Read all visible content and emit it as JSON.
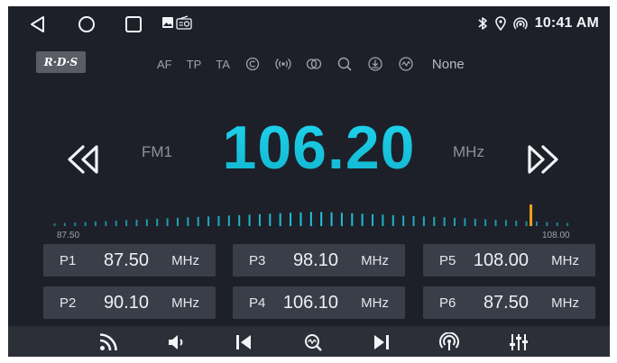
{
  "status": {
    "time": "10:41 AM",
    "icons": [
      "bluetooth-icon",
      "location-icon",
      "hotspot-icon"
    ]
  },
  "nav": [
    "back-icon",
    "home-icon",
    "recents-icon",
    "gallery-icon",
    "radio-icon"
  ],
  "rds": {
    "badge": "R·D·S",
    "items": [
      "AF",
      "TP",
      "TA"
    ],
    "icons": [
      "eon-icon",
      "broadcast-icon",
      "stereo-icon",
      "search-icon",
      "download-icon",
      "signal-icon"
    ],
    "none_label": "None"
  },
  "tuner": {
    "band": "FM1",
    "frequency": "106.20",
    "unit": "MHz",
    "scale_min_label": "87.50",
    "scale_max_label": "108.00",
    "scale_min": 87.5,
    "scale_max": 108.0,
    "current_value": 106.2,
    "accent": "#1fc9e2",
    "marker_color": "#f0a21a"
  },
  "presets": [
    {
      "num": "P1",
      "freq": "87.50",
      "unit": "MHz"
    },
    {
      "num": "P3",
      "freq": "98.10",
      "unit": "MHz"
    },
    {
      "num": "P5",
      "freq": "108.00",
      "unit": "MHz"
    },
    {
      "num": "P2",
      "freq": "90.10",
      "unit": "MHz"
    },
    {
      "num": "P4",
      "freq": "106.10",
      "unit": "MHz"
    },
    {
      "num": "P6",
      "freq": "87.50",
      "unit": "MHz"
    }
  ],
  "bottom_bar": [
    "rss-icon",
    "volume-icon",
    "prev-station-icon",
    "scan-icon",
    "next-station-icon",
    "antenna-icon",
    "equalizer-icon"
  ]
}
